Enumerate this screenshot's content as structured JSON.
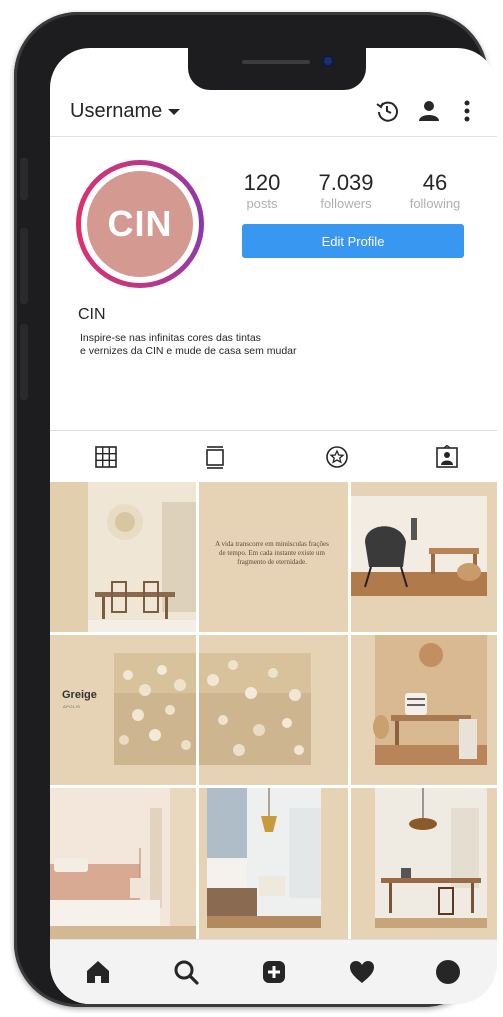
{
  "header": {
    "username": "Username",
    "icons": [
      "history-icon",
      "person-icon",
      "more-vertical-icon"
    ]
  },
  "profile": {
    "avatar_text": "CIN",
    "name": "CIN",
    "bio_line1": "Inspire-se nas infinitas cores das tintas",
    "bio_line2": "e vernizes da CIN  e mude de casa sem mudar",
    "edit_label": "Edit Profile"
  },
  "stats": [
    {
      "value": "120",
      "label": "posts"
    },
    {
      "value": "7.039",
      "label": "followers"
    },
    {
      "value": "46",
      "label": "following"
    }
  ],
  "tabs": [
    "grid-icon",
    "feed-icon",
    "saved-star-icon",
    "tagged-icon"
  ],
  "posts": {
    "quote": "A vida transcorre em minúsculas frações de tempo. Em cada instante existe um fragmento de eternidade.",
    "greige_title": "Greige",
    "greige_sub": "APOLIS"
  },
  "colors": {
    "accent": "#3897f0",
    "avatar_bg": "#d49a92",
    "ring": "#c13584",
    "beige": "#e6d3b5"
  },
  "bottom_nav": [
    "home-icon",
    "search-icon",
    "add-post-icon",
    "heart-icon",
    "profile-icon"
  ]
}
